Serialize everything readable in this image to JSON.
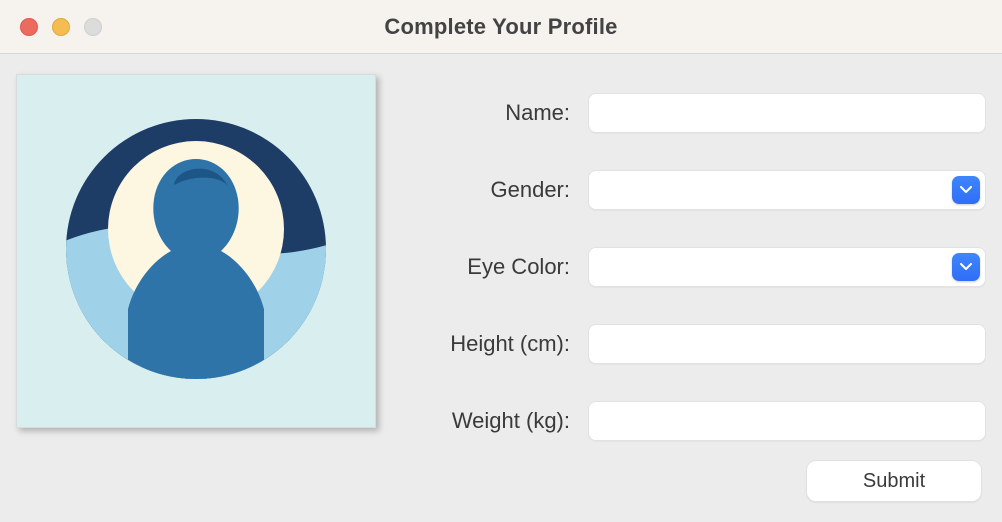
{
  "window": {
    "title": "Complete Your Profile"
  },
  "avatar": {
    "icon_name": "profile-avatar-icon"
  },
  "form": {
    "fields": {
      "name": {
        "label": "Name:",
        "value": "",
        "placeholder": ""
      },
      "gender": {
        "label": "Gender:",
        "value": ""
      },
      "eye": {
        "label": "Eye Color:",
        "value": ""
      },
      "height": {
        "label": "Height (cm):",
        "value": "",
        "placeholder": ""
      },
      "weight": {
        "label": "Weight (kg):",
        "value": "",
        "placeholder": ""
      }
    },
    "submit_label": "Submit"
  },
  "colors": {
    "accent": "#2f7af6",
    "background": "#ececec",
    "titlebar": "#f6f2ee"
  }
}
